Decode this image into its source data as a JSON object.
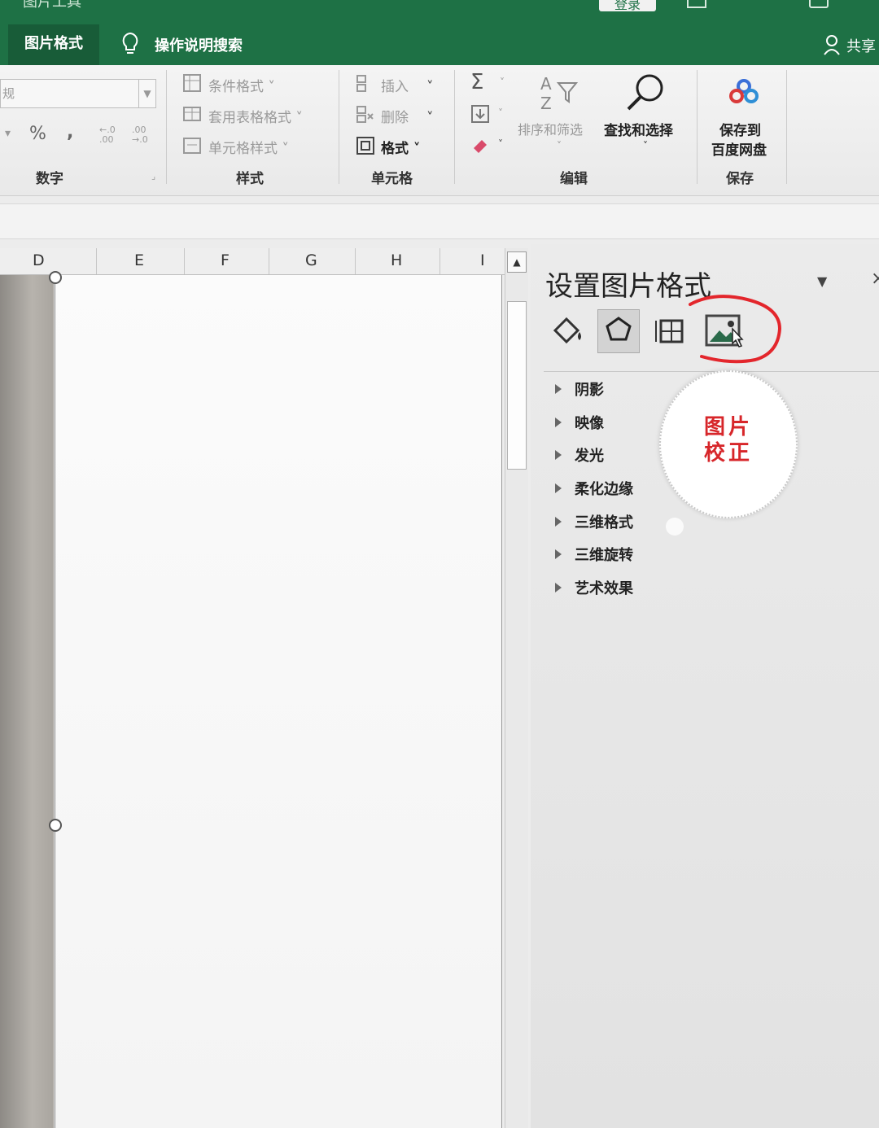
{
  "titlebar": {
    "tool_title": "图片工具",
    "login_label": "登录",
    "tab_picture_format": "图片格式",
    "tell_me": "操作说明搜索",
    "share": "共享"
  },
  "ribbon": {
    "number": {
      "format_value": "规",
      "percent": "%",
      "comma": ",",
      "increase_decimal": "←.0 .00",
      "decrease_decimal": ".00 →.0",
      "label": "数字"
    },
    "styles": {
      "conditional_format": "条件格式",
      "table_format": "套用表格格式",
      "cell_styles": "单元格样式",
      "label": "样式"
    },
    "cells": {
      "insert": "插入",
      "delete": "删除",
      "format": "格式",
      "label": "单元格"
    },
    "editing": {
      "sum_icon": "Σ",
      "sort_filter": "排序和筛选",
      "find_select": "查找和选择",
      "label": "编辑"
    },
    "save": {
      "save_to_line1": "保存到",
      "save_to_line2": "百度网盘",
      "label": "保存"
    }
  },
  "sheet": {
    "columns": [
      "D",
      "E",
      "F",
      "G",
      "H",
      "I"
    ]
  },
  "pane": {
    "title": "设置图片格式",
    "sections": [
      "阴影",
      "映像",
      "发光",
      "柔化边缘",
      "三维格式",
      "三维旋转",
      "艺术效果"
    ]
  },
  "annotation": {
    "callout_line1": "图片",
    "callout_line2": "校正"
  },
  "colors": {
    "excel_green": "#1e7145",
    "annotation_red": "#d7262a"
  }
}
